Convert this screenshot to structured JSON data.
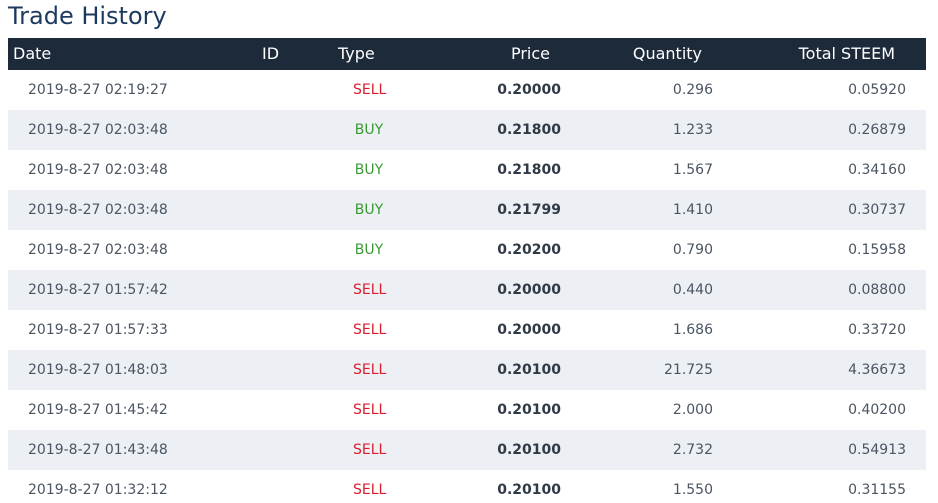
{
  "title": "Trade History",
  "columns": {
    "date": "Date",
    "id": "ID",
    "type": "Type",
    "price": "Price",
    "quantity": "Quantity",
    "total": "Total STEEM"
  },
  "colors": {
    "header_bg": "#1c2a3a",
    "title": "#1c3a5e",
    "sell": "#d91d2f",
    "buy": "#3a9a34",
    "row_alt": "#eceff3"
  },
  "rows": [
    {
      "date": "2019-8-27 02:19:27",
      "type": "SELL",
      "price": "0.20000",
      "quantity": "0.296",
      "total": "0.05920"
    },
    {
      "date": "2019-8-27 02:03:48",
      "type": "BUY",
      "price": "0.21800",
      "quantity": "1.233",
      "total": "0.26879"
    },
    {
      "date": "2019-8-27 02:03:48",
      "type": "BUY",
      "price": "0.21800",
      "quantity": "1.567",
      "total": "0.34160"
    },
    {
      "date": "2019-8-27 02:03:48",
      "type": "BUY",
      "price": "0.21799",
      "quantity": "1.410",
      "total": "0.30737"
    },
    {
      "date": "2019-8-27 02:03:48",
      "type": "BUY",
      "price": "0.20200",
      "quantity": "0.790",
      "total": "0.15958"
    },
    {
      "date": "2019-8-27 01:57:42",
      "type": "SELL",
      "price": "0.20000",
      "quantity": "0.440",
      "total": "0.08800"
    },
    {
      "date": "2019-8-27 01:57:33",
      "type": "SELL",
      "price": "0.20000",
      "quantity": "1.686",
      "total": "0.33720"
    },
    {
      "date": "2019-8-27 01:48:03",
      "type": "SELL",
      "price": "0.20100",
      "quantity": "21.725",
      "total": "4.36673"
    },
    {
      "date": "2019-8-27 01:45:42",
      "type": "SELL",
      "price": "0.20100",
      "quantity": "2.000",
      "total": "0.40200"
    },
    {
      "date": "2019-8-27 01:43:48",
      "type": "SELL",
      "price": "0.20100",
      "quantity": "2.732",
      "total": "0.54913"
    },
    {
      "date": "2019-8-27 01:32:12",
      "type": "SELL",
      "price": "0.20100",
      "quantity": "1.550",
      "total": "0.31155"
    }
  ]
}
